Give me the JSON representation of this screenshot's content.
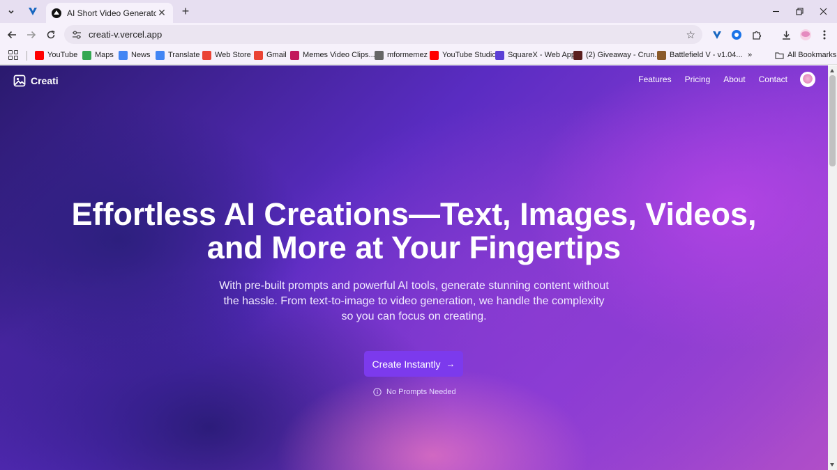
{
  "browser": {
    "tab_title": "AI Short Video Generator",
    "url": "creati-v.vercel.app",
    "bookmarks": [
      {
        "label": "YouTube",
        "icon": "youtube-icon",
        "color": "#ff0000"
      },
      {
        "label": "Maps",
        "icon": "maps-icon",
        "color": "#34a853"
      },
      {
        "label": "News",
        "icon": "news-icon",
        "color": "#4285f4"
      },
      {
        "label": "Translate",
        "icon": "translate-icon",
        "color": "#4285f4"
      },
      {
        "label": "Web Store",
        "icon": "webstore-icon",
        "color": "#ea4335"
      },
      {
        "label": "Gmail",
        "icon": "gmail-icon",
        "color": "#ea4335"
      },
      {
        "label": "Memes Video Clips...",
        "icon": "memes-icon",
        "color": "#c2185b"
      },
      {
        "label": "mformemez",
        "icon": "mformemez-icon",
        "color": "#666666"
      },
      {
        "label": "YouTube Studio",
        "icon": "youtube-studio-icon",
        "color": "#ff0000"
      },
      {
        "label": "SquareX - Web App",
        "icon": "squarex-icon",
        "color": "#5b3fd6"
      },
      {
        "label": "(2) Giveaway - Crun...",
        "icon": "giveaway-icon",
        "color": "#5a1f1f"
      },
      {
        "label": "Battlefield V - v1.04...",
        "icon": "battlefield-icon",
        "color": "#8a5a2b"
      }
    ],
    "all_bookmarks": "All Bookmarks"
  },
  "site": {
    "brand": "Creati",
    "nav": [
      "Features",
      "Pricing",
      "About",
      "Contact"
    ],
    "hero_title": "Effortless AI Creations—Text, Images, Videos, and More at Your Fingertips",
    "hero_subtitle": "With pre-built prompts and powerful AI tools, generate stunning content without the hassle. From text-to-image to video generation, we handle the complexity so you can focus on creating.",
    "cta_label": "Create Instantly",
    "cta_note": "No Prompts Needed",
    "accent_color": "#7c3aed"
  }
}
